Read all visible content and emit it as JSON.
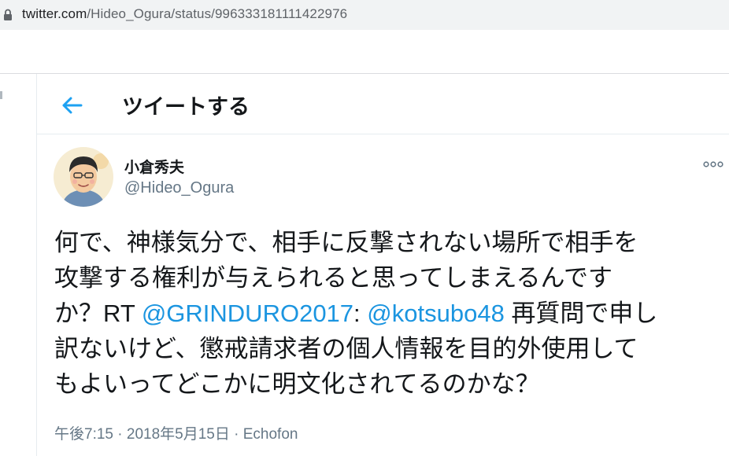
{
  "browser": {
    "url_domain": "twitter.com",
    "url_path": "/Hideo_Ogura/status/996333181111422976",
    "lock_icon": "lock-icon"
  },
  "header": {
    "back_icon": "arrow-left-icon",
    "title": "ツイートする"
  },
  "tweet": {
    "author": {
      "name": "小倉秀夫",
      "handle": "@Hideo_Ogura"
    },
    "more_icon": "more-horizontal-icon",
    "body": {
      "text1": "何で、神様気分で、相手に反撃されない場所で相手を",
      "text2": "攻撃する権利が与えられると思ってしまえるんです",
      "text3": "か？RT ",
      "mention1": "@GRINDURO2017",
      "text4": ": ",
      "mention2": "@kotsubo48",
      "text5": " 再質問で申し",
      "text6": "訳ないけど、懲戒請求者の個人情報を目的外使用して",
      "text7": "もよいってどこかに明文化されてるのかな？"
    },
    "meta": {
      "time": "午後7:15",
      "separator": " · ",
      "date": "2018年5月15日",
      "source": "Echofon"
    }
  },
  "colors": {
    "accent": "#1da1f2",
    "link": "#1b95e0",
    "text_primary": "#14171a",
    "text_secondary": "#657786"
  }
}
